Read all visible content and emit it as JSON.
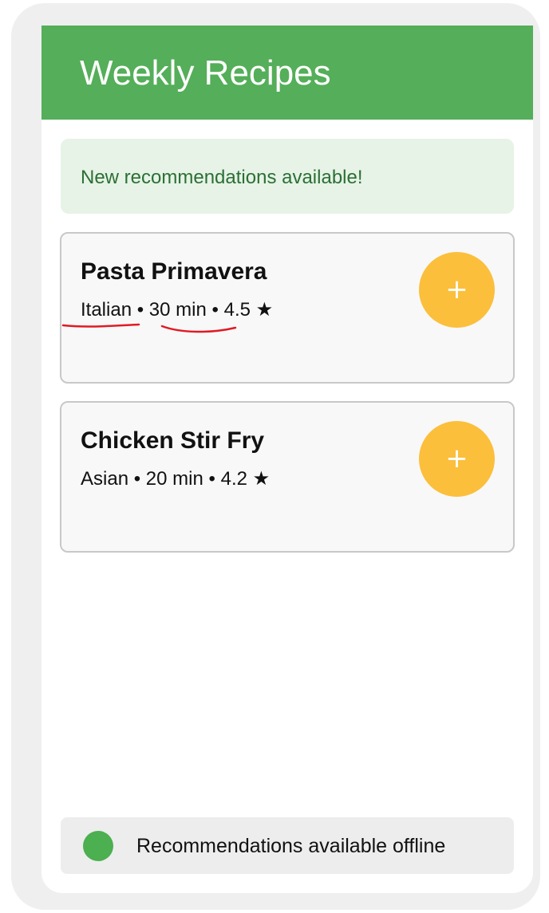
{
  "header": {
    "title": "Weekly Recipes"
  },
  "banner": {
    "text": "New recommendations available!"
  },
  "recipes": [
    {
      "name": "Pasta Primavera",
      "cuisine": "Italian",
      "time": "30 min",
      "rating": "4.5 ★",
      "separator": " • ",
      "add_label": "+"
    },
    {
      "name": "Chicken Stir Fry",
      "cuisine": "Asian",
      "time": "20 min",
      "rating": "4.2 ★",
      "separator": " • ",
      "add_label": "+"
    }
  ],
  "status": {
    "text": "Recommendations available offline",
    "dot_color": "#4caf50"
  },
  "colors": {
    "header": "#55ae59",
    "accent": "#fbbf3c",
    "banner_background": "#e6f3e6",
    "banner_text": "#2c6f36",
    "annotation": "#e01b24"
  }
}
